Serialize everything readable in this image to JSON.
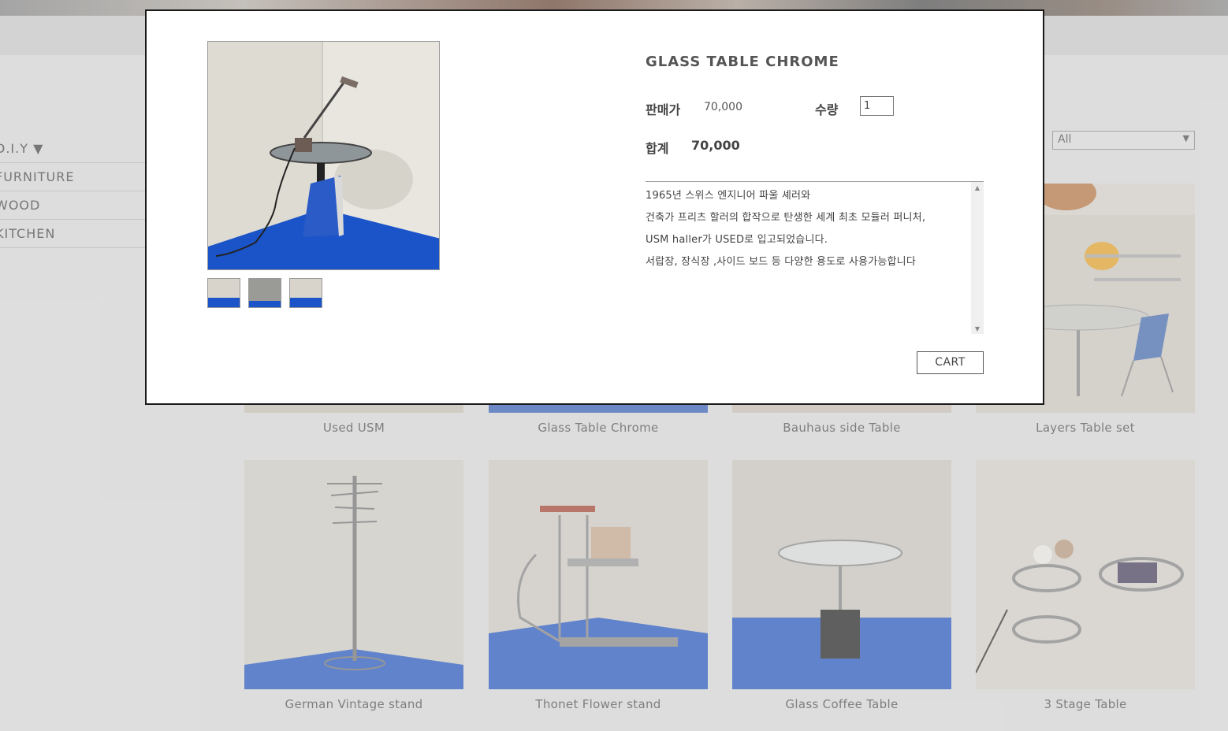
{
  "sidebar": {
    "title": "D.I.Y ▼",
    "items": [
      {
        "label": "FURNITURE"
      },
      {
        "label": "WOOD"
      },
      {
        "label": "KITCHEN"
      }
    ]
  },
  "sort": {
    "selected": "All"
  },
  "products_row1": [
    {
      "name": "Used USM"
    },
    {
      "name": "Glass Table Chrome"
    },
    {
      "name": "Bauhaus side Table"
    },
    {
      "name": "Layers Table set"
    }
  ],
  "products_row2": [
    {
      "name": "German Vintage stand"
    },
    {
      "name": "Thonet Flower stand"
    },
    {
      "name": "Glass Coffee Table"
    },
    {
      "name": "3 Stage Table"
    }
  ],
  "modal": {
    "title": "GLASS TABLE CHROME",
    "price_label": "판매가",
    "price": "70,000",
    "qty_label": "수량",
    "qty_value": "1",
    "total_label": "합계",
    "total": "70,000",
    "description": [
      "1965년 스위스 엔지니어 파울 셰러와",
      "건축가 프리츠 할러의 합작으로 탄생한 세계 최초 모듈러 퍼니처,",
      "USM haller가 USED로 입고되었습니다.",
      "서랍장, 장식장 ,사이드 보드 등 다양한 용도로 사용가능합니다"
    ],
    "cart_label": "CART"
  },
  "colors": {
    "accent_blue": "#1b54c8",
    "modal_border": "#1a1a1a",
    "overlay": "#d9d9d9"
  }
}
